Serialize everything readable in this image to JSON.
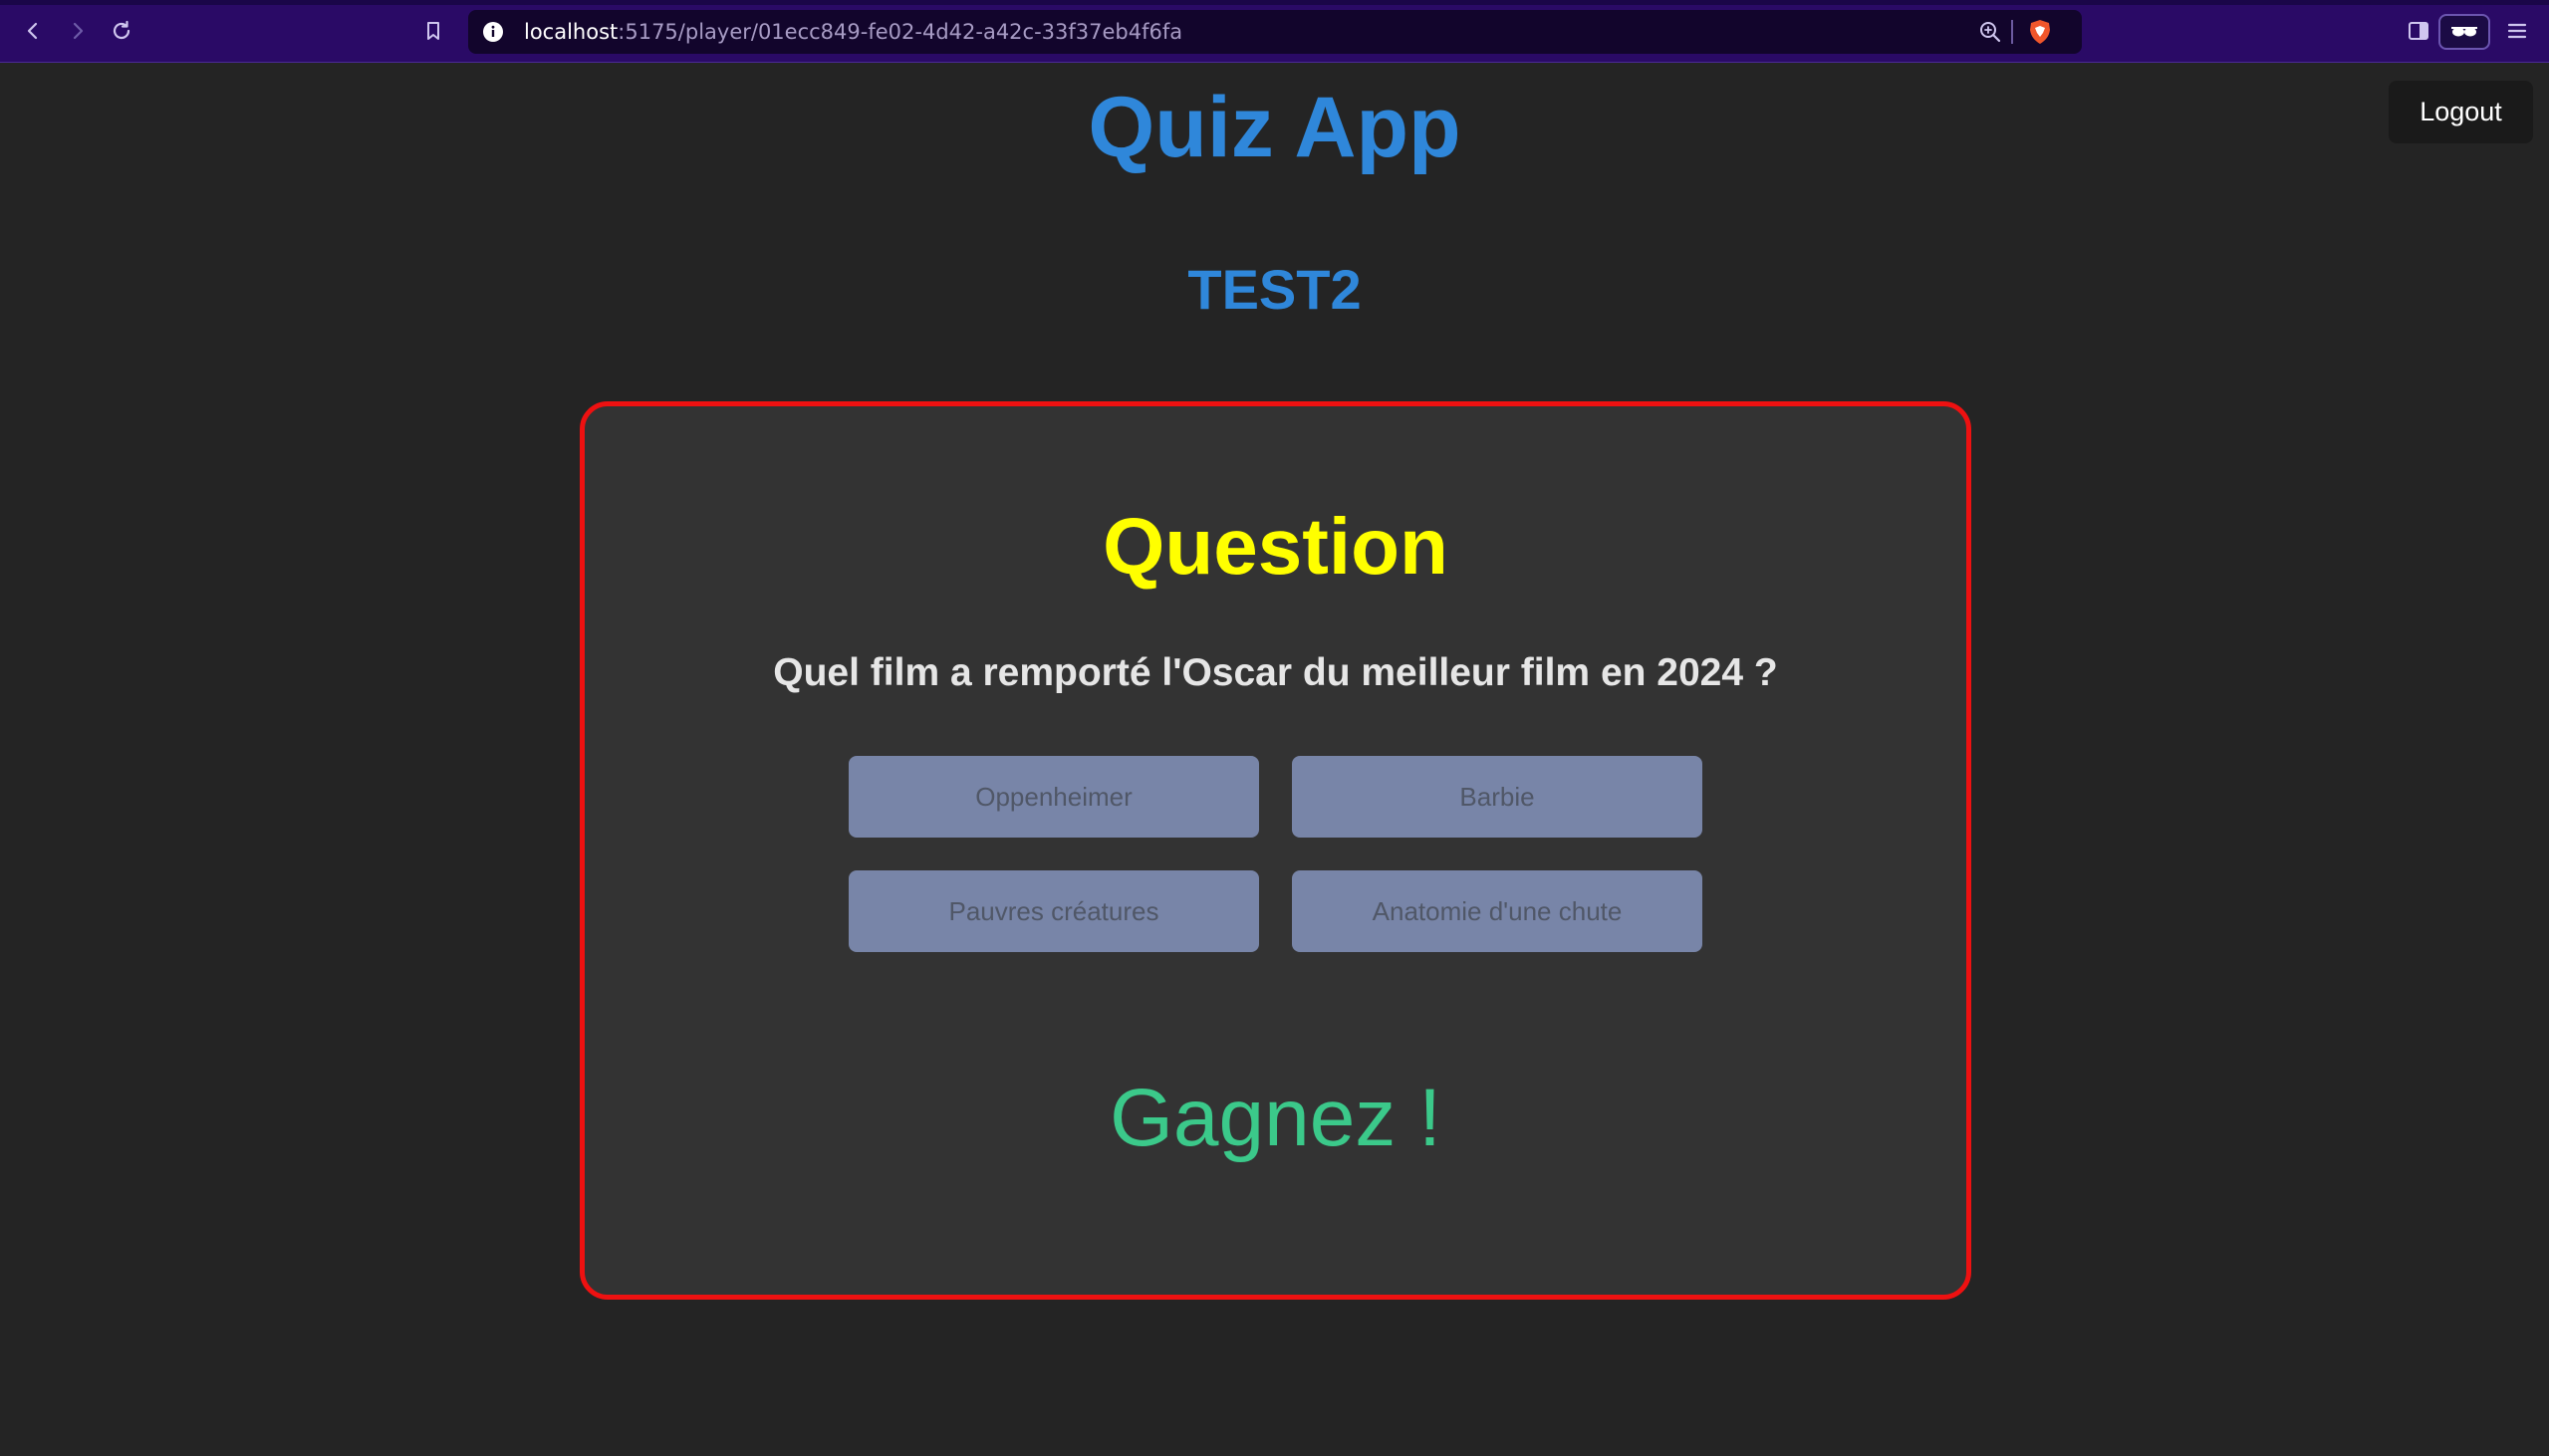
{
  "browser": {
    "url_host": "localhost",
    "url_rest": ":5175/player/01ecc849-fe02-4d42-a42c-33f37eb4f6fa",
    "icons": [
      "back-icon",
      "forward-icon",
      "reload-icon",
      "bookmark-icon",
      "site-info-icon",
      "zoom-icon",
      "brave-shield-icon",
      "sidebar-icon",
      "private-window-icon",
      "menu-icon"
    ]
  },
  "header": {
    "title": "Quiz App",
    "logout_label": "Logout"
  },
  "quiz": {
    "name": "TEST2"
  },
  "card": {
    "heading": "Question",
    "question": "Quel film a remporté l'Oscar du meilleur film en 2024 ?",
    "answers": [
      "Oppenheimer",
      "Barbie",
      "Pauvres créatures",
      "Anatomie d'une chute"
    ],
    "result": "Gagnez !"
  },
  "colors": {
    "page_background": "#242424",
    "title": "#2f87da",
    "card_border": "#ee1111",
    "heading": "#ffff00",
    "result": "#3bc98a",
    "answer_button": "#7885a8"
  }
}
